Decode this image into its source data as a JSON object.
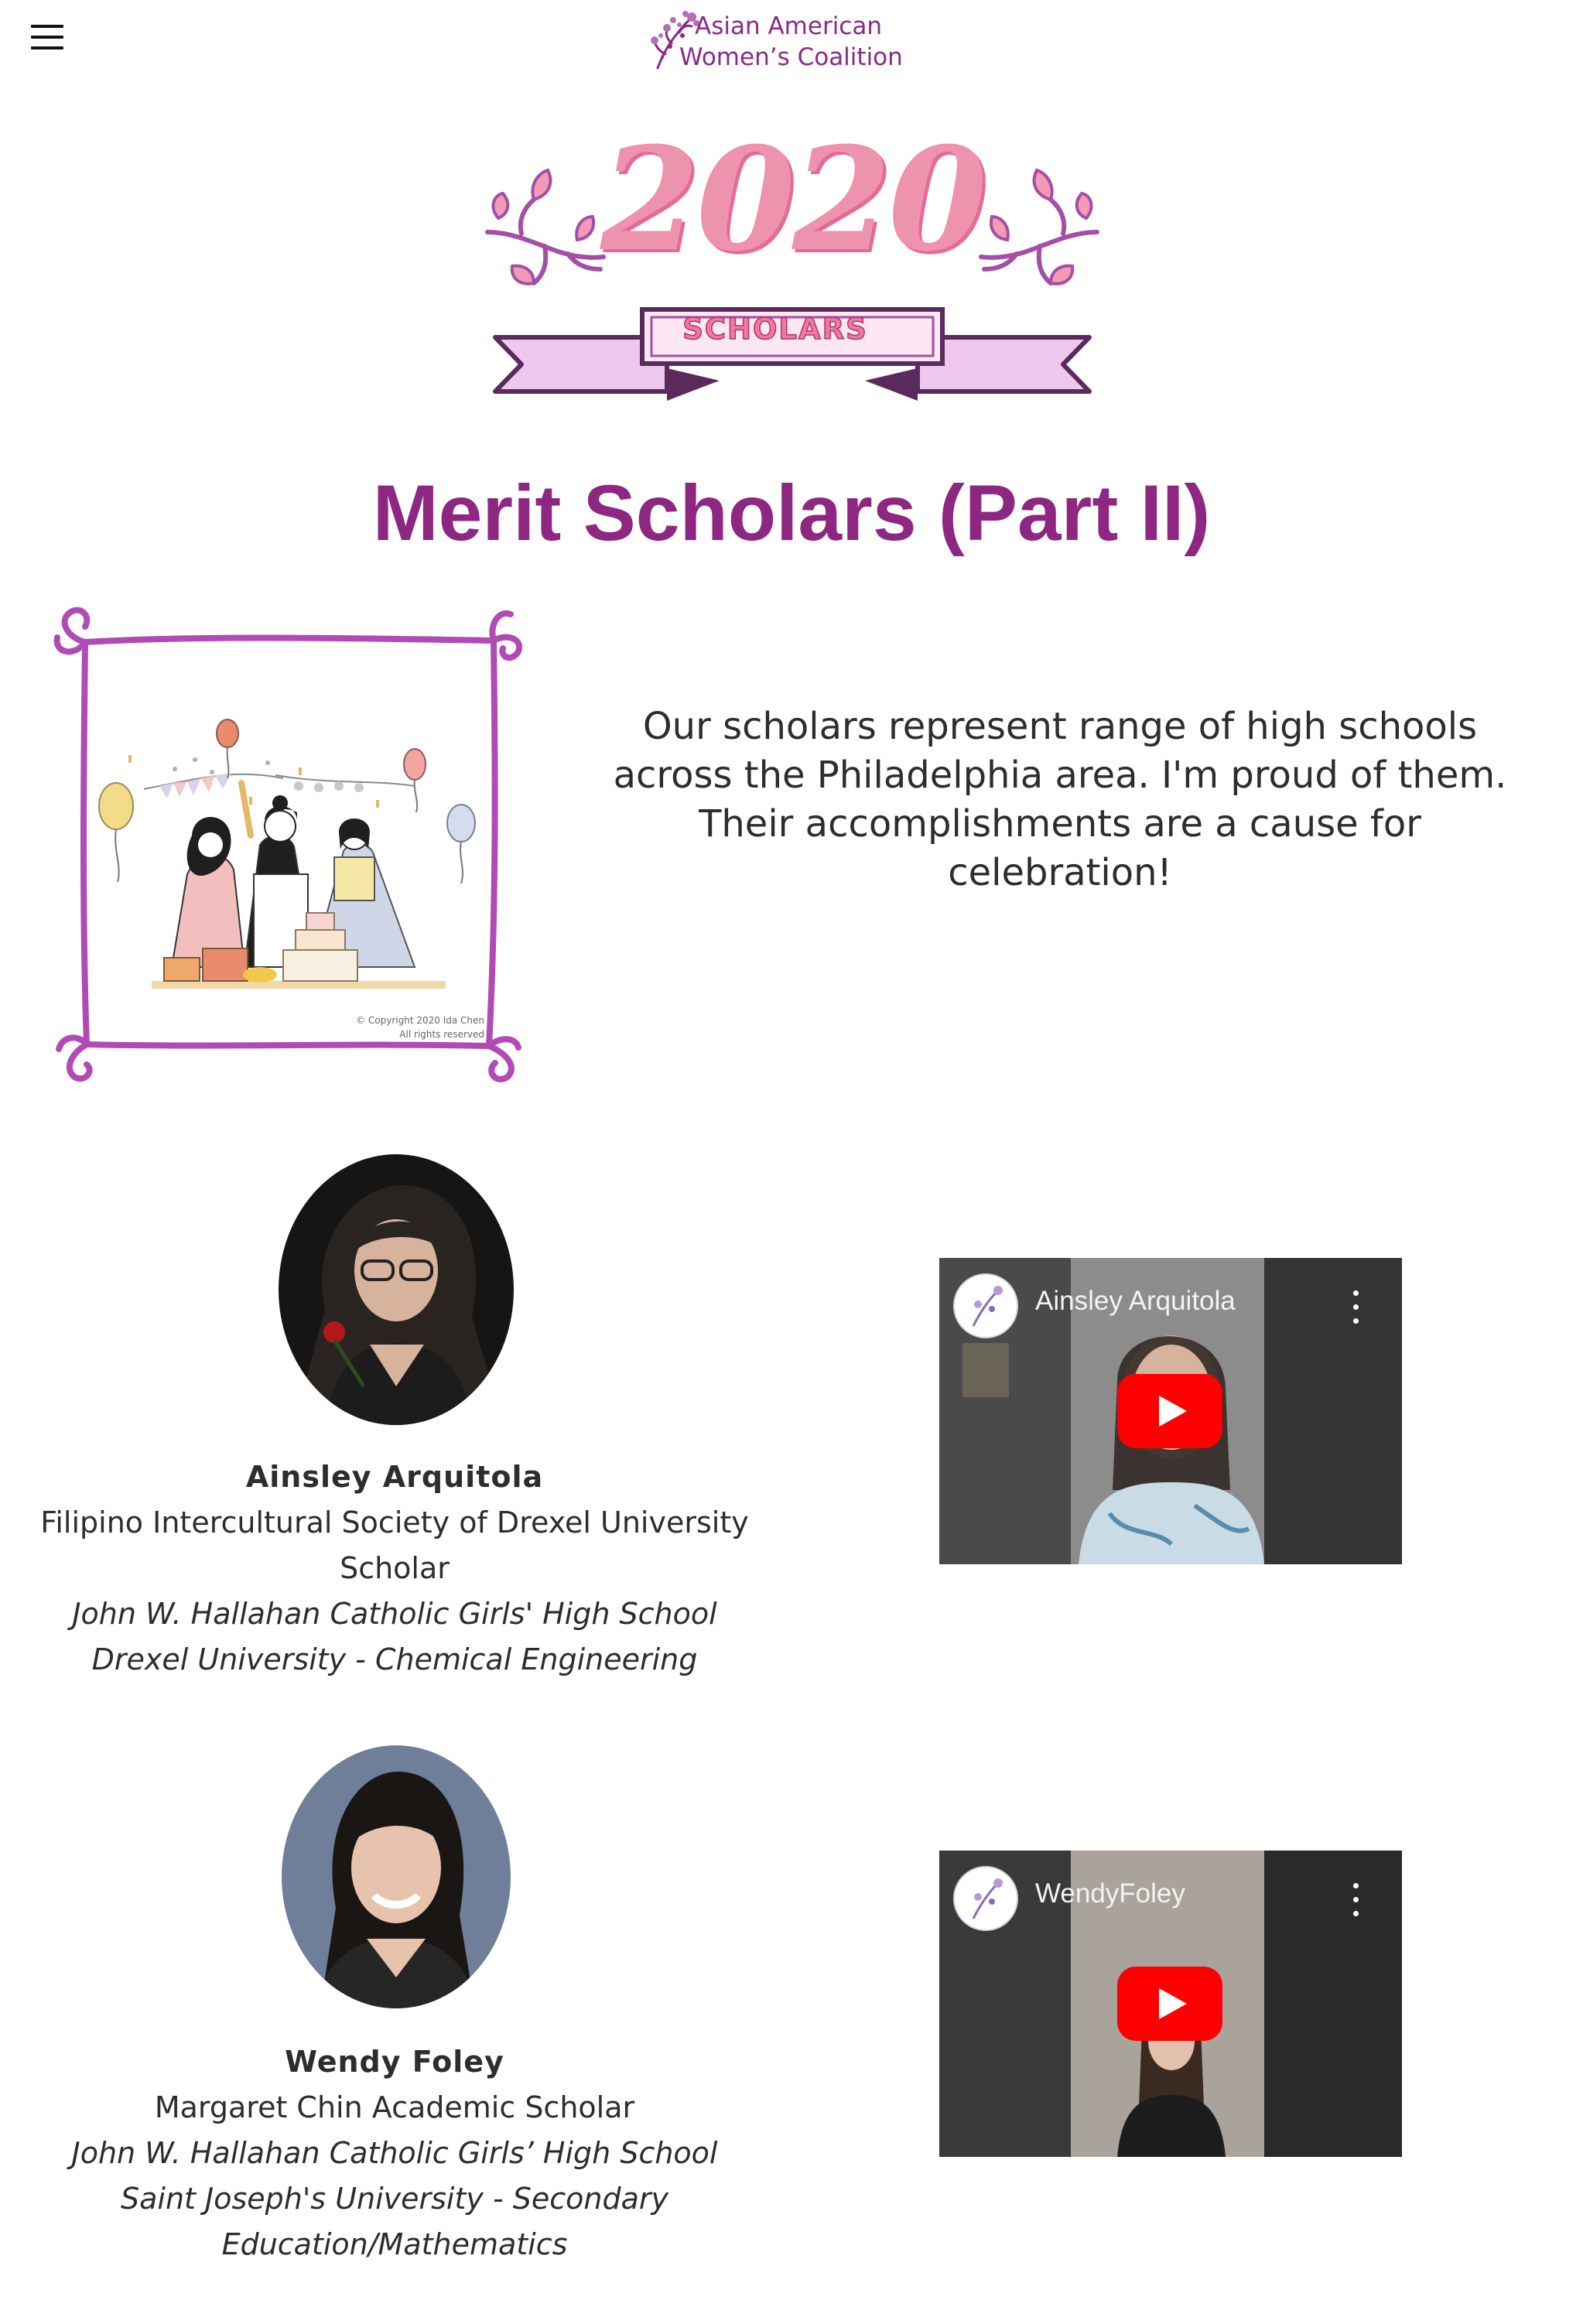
{
  "header": {
    "menu_icon": "hamburger-menu-icon",
    "logo": {
      "line1": "Asian American",
      "line2": "Women’s Coalition",
      "color": "#8a2a86"
    }
  },
  "banner": {
    "year": "2020",
    "label": "SCHOLARS",
    "colors": {
      "pink": "#ee93ad",
      "purple": "#a44ea6",
      "ribbon": "#eec8ec"
    }
  },
  "page_title": "Merit Scholars (Part II)",
  "intro": {
    "illustration_credit_line1": "© Copyright 2020 Ida Chen",
    "illustration_credit_line2": "All rights reserved",
    "text": "Our scholars represent range of high schools across the Philadelphia area.  I'm proud of them.  Their accomplishments are a cause for celebration!"
  },
  "scholars": [
    {
      "name": "Ainsley Arquitola",
      "award_line1": "Filipino Intercultural Society of Drexel University",
      "award_line2": "Scholar",
      "high_school": "John W. Hallahan Catholic Girls' High School",
      "college_line1": "Drexel University - Chemical Engineering",
      "video_title": "Ainsley Arquitola"
    },
    {
      "name": "Wendy Foley",
      "award_line1": "Margaret Chin Academic Scholar",
      "high_school": "John W. Hallahan Catholic Girls’ High School",
      "college_line1": "Saint Joseph's University - Secondary",
      "college_line2": "Education/Mathematics",
      "video_title": "WendyFoley"
    }
  ],
  "theme": {
    "title_color": "#8d2781",
    "frame_color": "#b04bb5",
    "youtube_red": "#ff0000"
  }
}
